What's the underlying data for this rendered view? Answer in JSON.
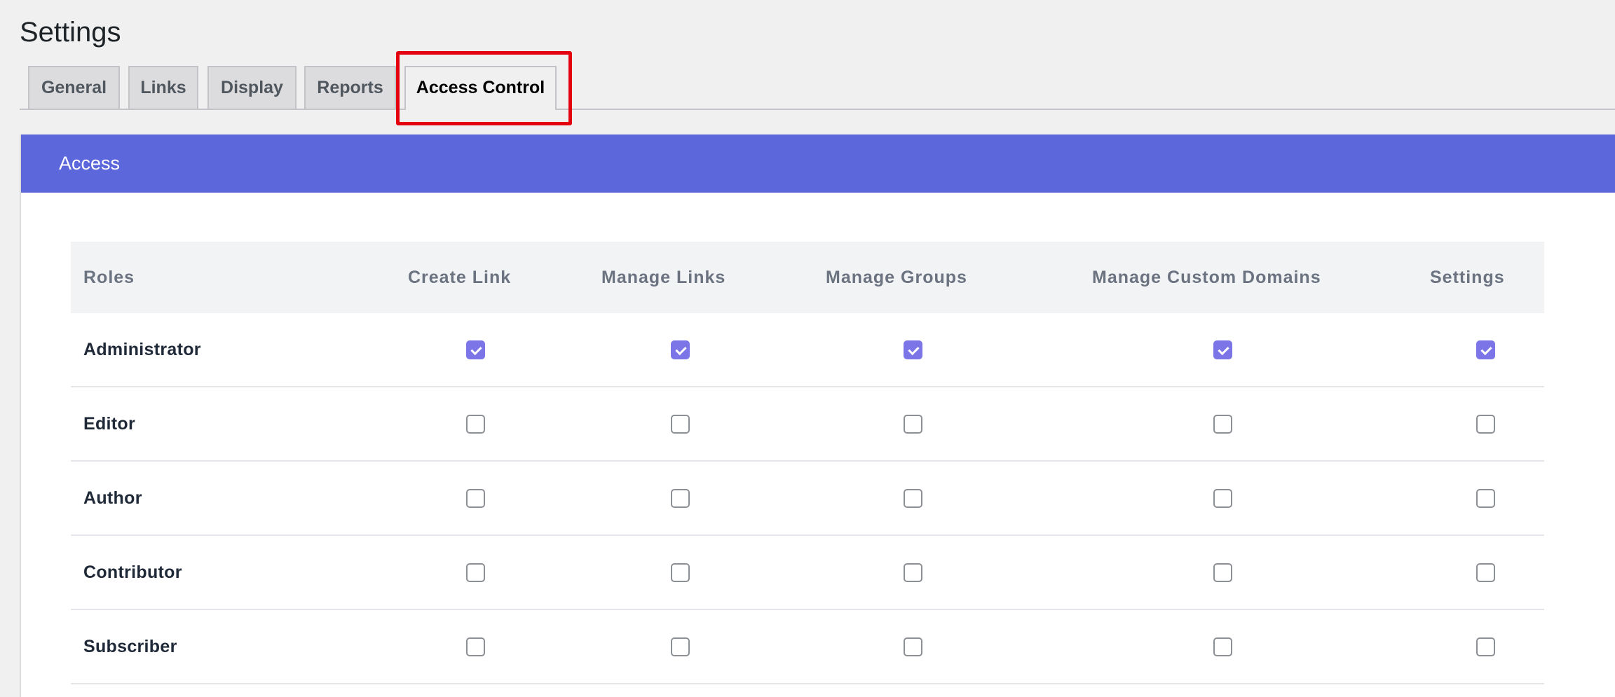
{
  "page": {
    "title": "Settings"
  },
  "tabs": [
    {
      "label": "General",
      "active": false
    },
    {
      "label": "Links",
      "active": false
    },
    {
      "label": "Display",
      "active": false
    },
    {
      "label": "Reports",
      "active": false
    },
    {
      "label": "Access Control",
      "active": true
    }
  ],
  "panel": {
    "title": "Access"
  },
  "table": {
    "headers": [
      "Roles",
      "Create Link",
      "Manage Links",
      "Manage Groups",
      "Manage Custom Domains",
      "Settings"
    ],
    "rows": [
      {
        "role": "Administrator",
        "permissions": [
          true,
          true,
          true,
          true,
          true
        ]
      },
      {
        "role": "Editor",
        "permissions": [
          false,
          false,
          false,
          false,
          false
        ]
      },
      {
        "role": "Author",
        "permissions": [
          false,
          false,
          false,
          false,
          false
        ]
      },
      {
        "role": "Contributor",
        "permissions": [
          false,
          false,
          false,
          false,
          false
        ]
      },
      {
        "role": "Subscriber",
        "permissions": [
          false,
          false,
          false,
          false,
          false
        ]
      }
    ]
  },
  "colors": {
    "accent": "#5b67da",
    "checkbox_checked": "#7b75e8",
    "highlight_box": "#e3000f"
  }
}
